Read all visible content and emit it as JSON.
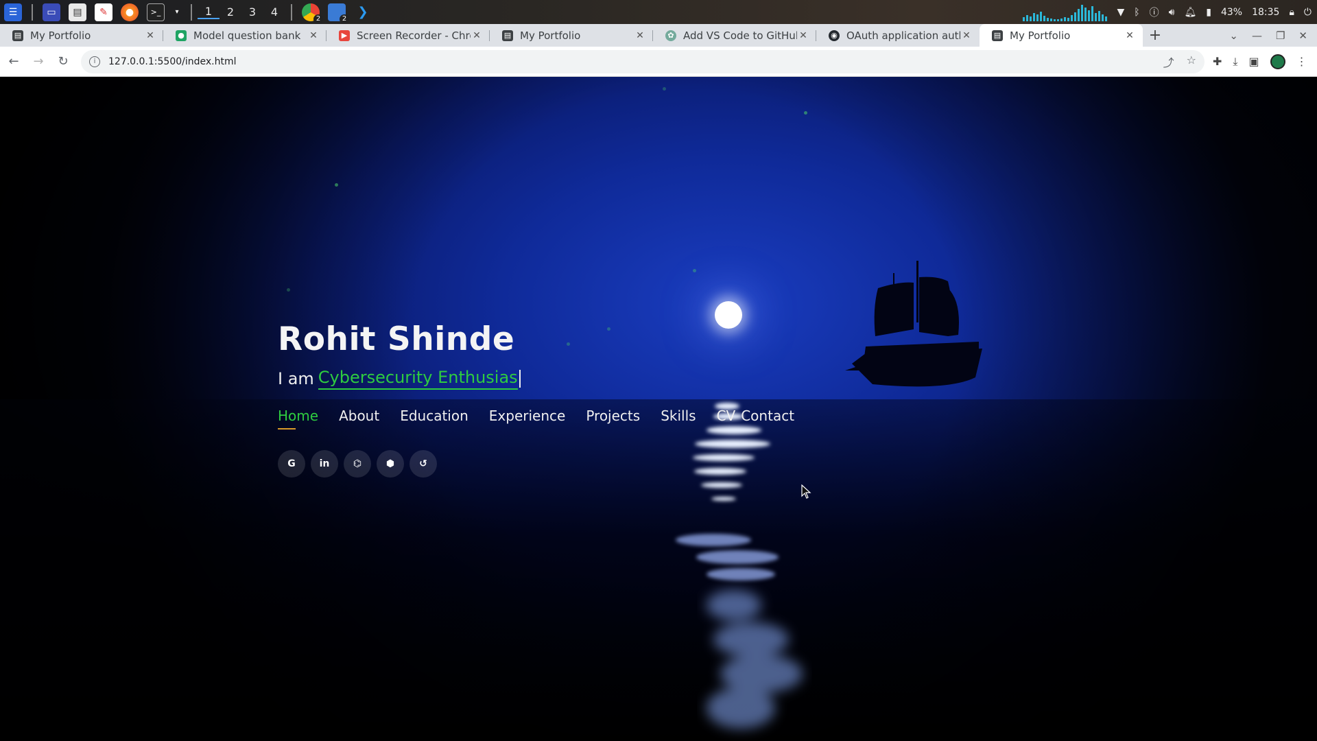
{
  "os_panel": {
    "workspaces": [
      "1",
      "2",
      "3",
      "4"
    ],
    "active_workspace": "1",
    "launcher_badges": [
      "2",
      "2"
    ],
    "battery": "43%",
    "clock": "18:35"
  },
  "browser": {
    "tabs": [
      {
        "title": "My Portfolio",
        "favicon": "portfolio-icon",
        "color": "#3c4043"
      },
      {
        "title": "Model question bank",
        "favicon": "classroom-icon",
        "color": "#1fa463"
      },
      {
        "title": "Screen Recorder - Chrom",
        "favicon": "recorder-icon",
        "color": "#e8453c"
      },
      {
        "title": "My Portfolio",
        "favicon": "portfolio-icon",
        "color": "#3c4043"
      },
      {
        "title": "Add VS Code to GitHub",
        "favicon": "chatgpt-icon",
        "color": "#74aa9c"
      },
      {
        "title": "OAuth application author",
        "favicon": "github-icon",
        "color": "#24292f"
      },
      {
        "title": "My Portfolio",
        "favicon": "portfolio-icon",
        "color": "#3c4043"
      }
    ],
    "active_tab": 6,
    "url": "127.0.0.1:5500/index.html"
  },
  "page": {
    "name": "Rohit Shinde",
    "typed_prefix": "I am",
    "typed_role": "Cybersecurity Enthusias",
    "nav": [
      "Home",
      "About",
      "Education",
      "Experience",
      "Projects",
      "Skills",
      "CV",
      "Contact"
    ],
    "active_nav": "Home",
    "socials": [
      {
        "name": "google",
        "glyph": "G"
      },
      {
        "name": "linkedin",
        "glyph": "in"
      },
      {
        "name": "github",
        "glyph": "⌬"
      },
      {
        "name": "hackthebox",
        "glyph": "⬢"
      },
      {
        "name": "leetcode",
        "glyph": "↺"
      }
    ],
    "accent": "#2ecc40",
    "underline_color": "#d89a2a"
  }
}
